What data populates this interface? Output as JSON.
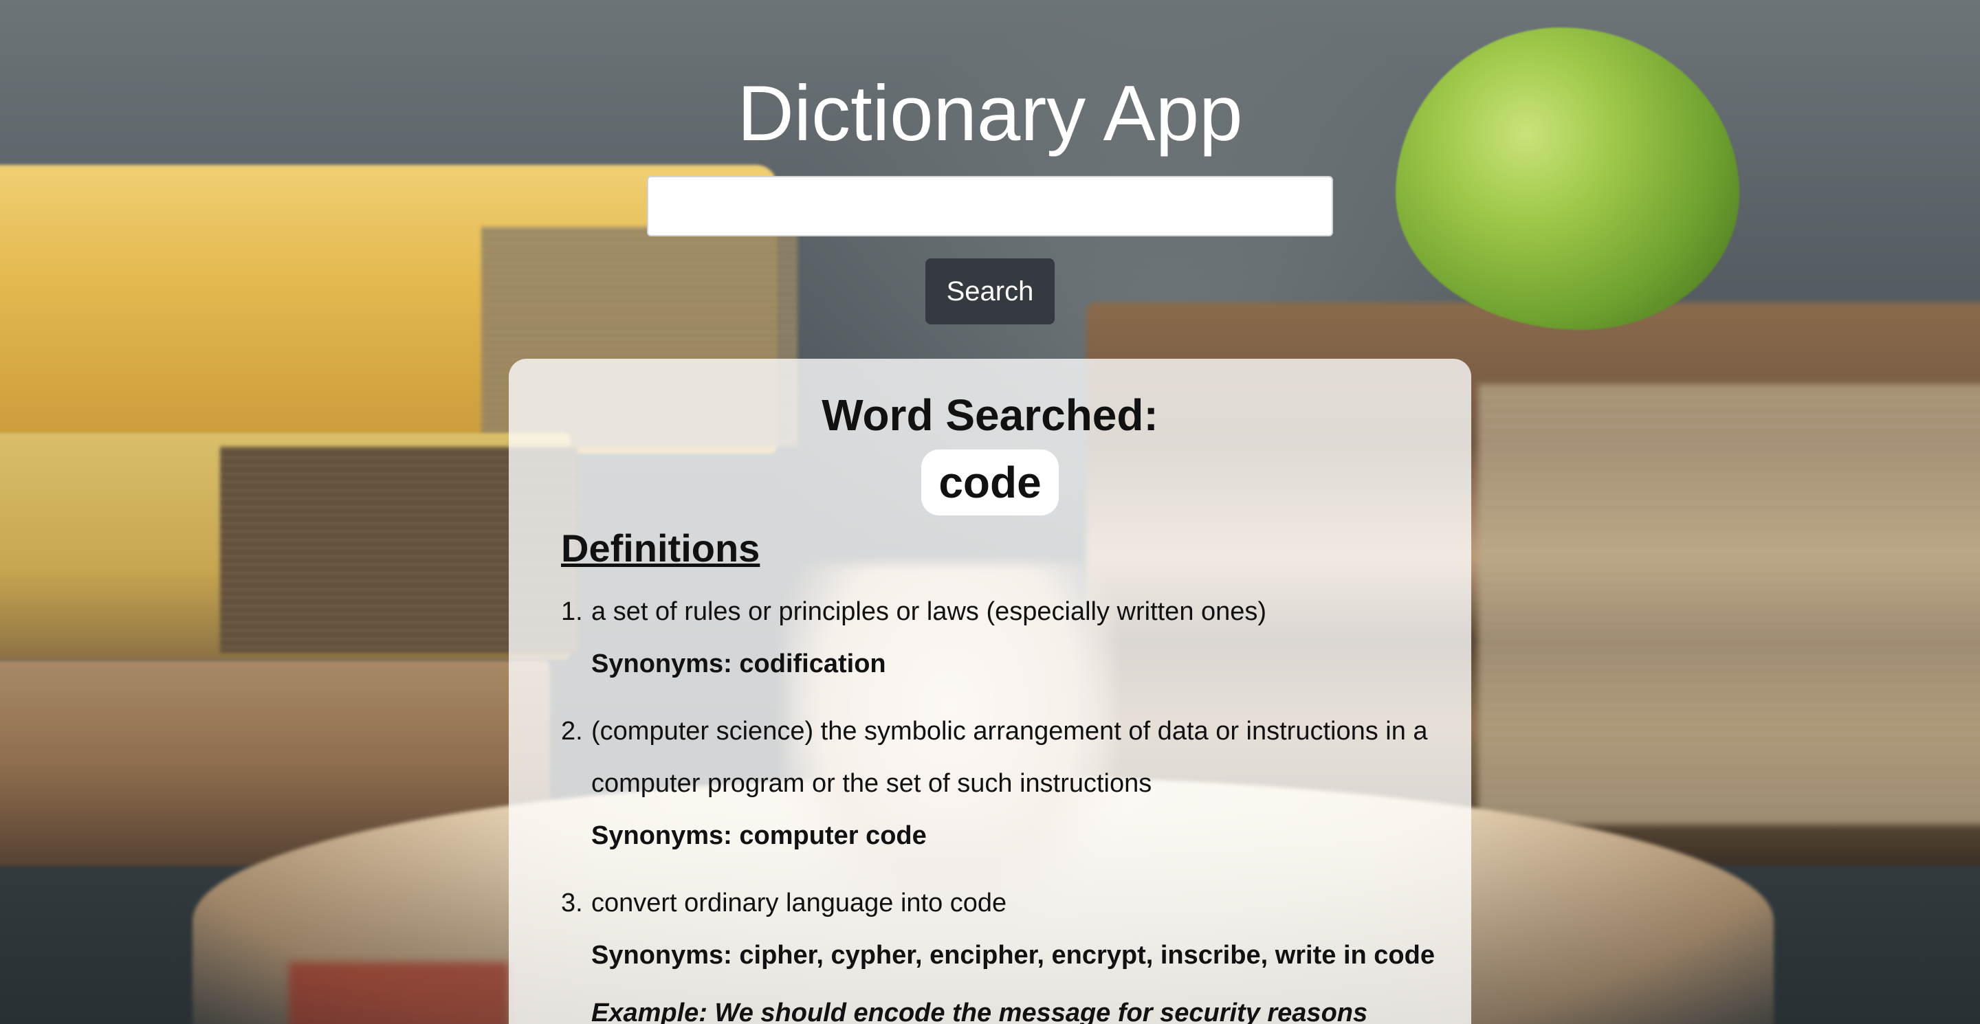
{
  "app": {
    "title": "Dictionary App"
  },
  "search": {
    "value": "",
    "placeholder": "",
    "button_label": "Search"
  },
  "result": {
    "word_label": "Word Searched:",
    "word": "code",
    "definitions_heading": "Definitions",
    "definitions": [
      {
        "number": "1.",
        "text": "a set of rules or principles or laws (especially written ones)",
        "synonyms": "Synonyms: codification"
      },
      {
        "number": "2.",
        "text": "(computer science) the symbolic arrangement of data or instructions in a computer program or the set of such instructions",
        "synonyms": "Synonyms: computer code"
      },
      {
        "number": "3.",
        "text": "convert ordinary language into code",
        "synonyms": "Synonyms: cipher, cypher, encipher, encrypt, inscribe, write in code",
        "example": "Example: We should encode the message for security reasons"
      }
    ]
  },
  "colors": {
    "button_bg": "#343a40",
    "card_bg": "rgba(255,255,255,0.78)",
    "title_text": "#ffffff"
  }
}
